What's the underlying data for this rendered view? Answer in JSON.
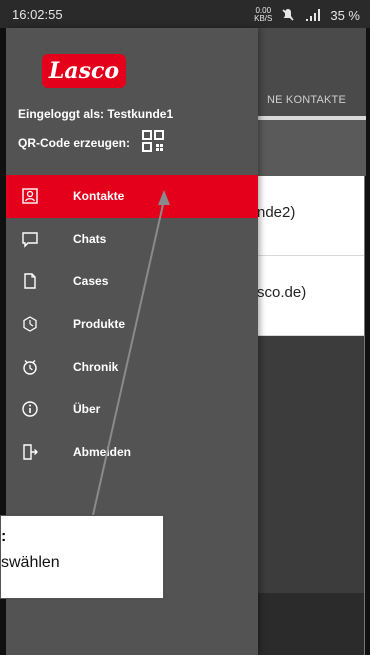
{
  "status": {
    "time": "16:02:55",
    "net_speed": "0.00\nKB/S",
    "battery": "35 %"
  },
  "topbar": {
    "tab_label": "NE KONTAKTE"
  },
  "content": {
    "row1_text": "nde2)",
    "row2_text": "sco.de)"
  },
  "drawer": {
    "logo_text": "Lasco",
    "logged_in": "Eingeloggt als: Testkunde1",
    "qr_label": "QR-Code erzeugen:",
    "items": [
      {
        "label": "Kontakte",
        "icon": "contacts-icon"
      },
      {
        "label": "Chats",
        "icon": "chat-icon"
      },
      {
        "label": "Cases",
        "icon": "cases-icon"
      },
      {
        "label": "Produkte",
        "icon": "products-icon"
      },
      {
        "label": "Chronik",
        "icon": "history-icon"
      },
      {
        "label": "Über",
        "icon": "info-icon"
      },
      {
        "label": "Abmelden",
        "icon": "logout-icon"
      }
    ]
  },
  "callout": {
    "line1": ":",
    "line2": "swählen"
  },
  "colors": {
    "accent": "#e4001b",
    "drawer_bg": "#535353",
    "topbar_bg": "#4a4a4a"
  }
}
